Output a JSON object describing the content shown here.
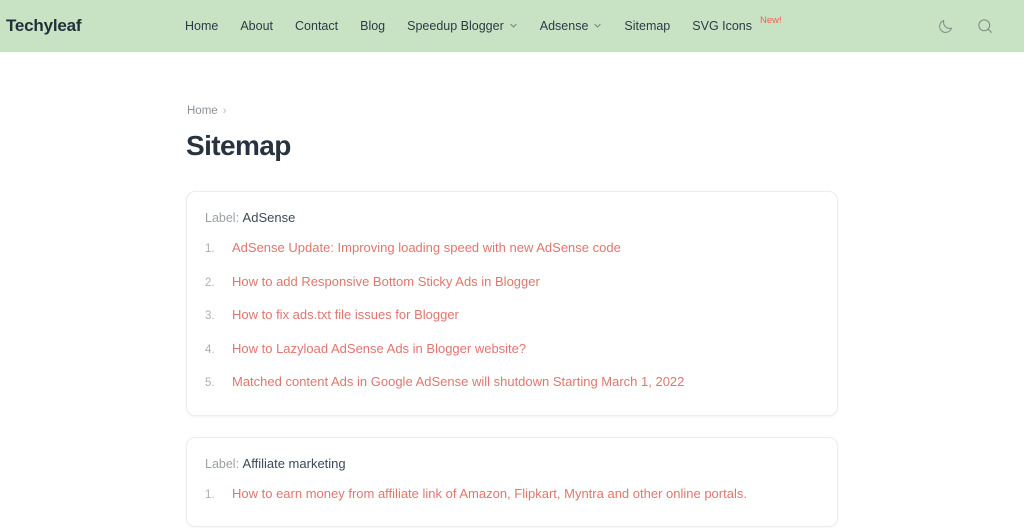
{
  "header": {
    "brand": "Techyleaf",
    "nav": [
      {
        "label": "Home",
        "has_dropdown": false,
        "badge": ""
      },
      {
        "label": "About",
        "has_dropdown": false,
        "badge": ""
      },
      {
        "label": "Contact",
        "has_dropdown": false,
        "badge": ""
      },
      {
        "label": "Blog",
        "has_dropdown": false,
        "badge": ""
      },
      {
        "label": "Speedup Blogger",
        "has_dropdown": true,
        "badge": ""
      },
      {
        "label": "Adsense",
        "has_dropdown": true,
        "badge": ""
      },
      {
        "label": "Sitemap",
        "has_dropdown": false,
        "badge": ""
      },
      {
        "label": "SVG Icons",
        "has_dropdown": false,
        "badge": "New!"
      }
    ],
    "actions": [
      {
        "icon": "moon-icon",
        "name": "dark-mode-toggle"
      },
      {
        "icon": "search-icon",
        "name": "search-button"
      }
    ],
    "colors": {
      "background": "#c8e3c4",
      "brand_text": "#22303d",
      "nav_text": "#2c3a45",
      "badge_new": "#e8645c"
    }
  },
  "breadcrumb": {
    "items": [
      "Home"
    ],
    "separator": "›"
  },
  "page": {
    "title": "Sitemap",
    "title_color": "#27333f"
  },
  "cards": [
    {
      "label_prefix": "Label:",
      "label_value": "AdSense",
      "posts": [
        "AdSense Update: Improving loading speed with new AdSense code",
        "How to add Responsive Bottom Sticky Ads in Blogger",
        "How to fix ads.txt file issues for Blogger",
        "How to Lazyload AdSense Ads in Blogger website?",
        "Matched content Ads in Google AdSense will shutdown Starting March 1, 2022"
      ]
    },
    {
      "label_prefix": "Label:",
      "label_value": "Affiliate marketing",
      "posts": [
        "How to earn money from affiliate link of Amazon, Flipkart, Myntra and other online portals."
      ]
    }
  ],
  "theme": {
    "link_color": "#e0766f",
    "card_background": "#ffffff",
    "card_border": "#ececec",
    "page_background": "#ffffff",
    "muted_text": "#9aa1a7"
  }
}
